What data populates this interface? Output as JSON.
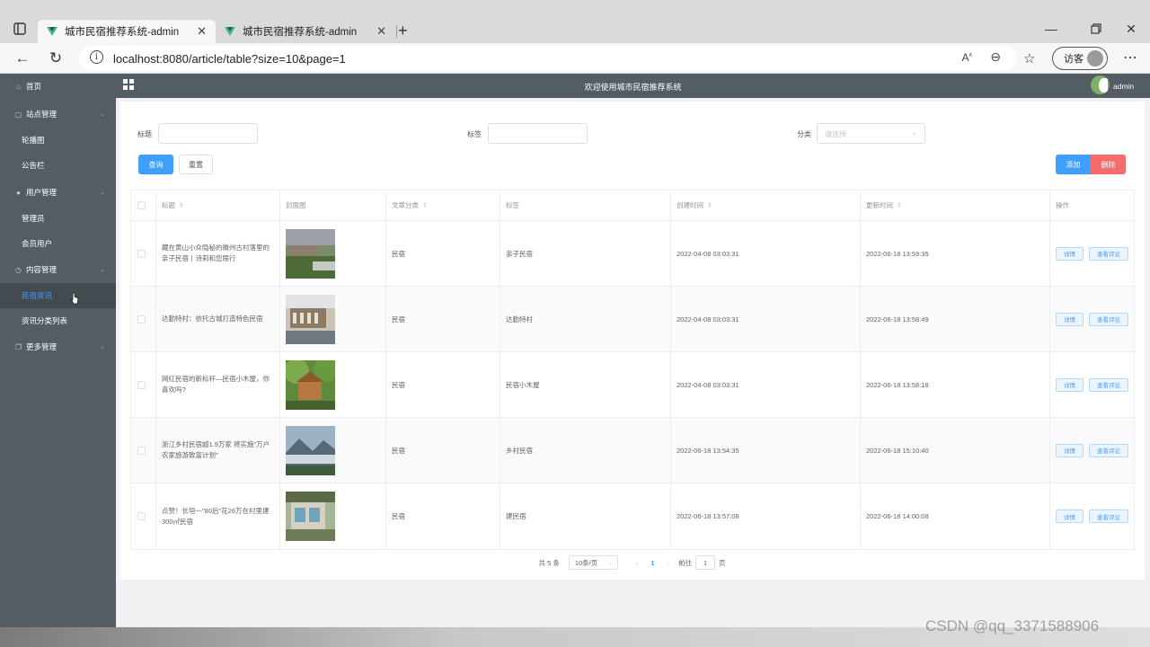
{
  "browser": {
    "tabs": [
      {
        "title": "城市民宿推荐系统-admin",
        "active": true
      },
      {
        "title": "城市民宿推荐系统-admin",
        "active": false
      }
    ],
    "url": "localhost:8080/article/table?size=10&page=1",
    "guest_label": "访客"
  },
  "sidebar": {
    "items": [
      {
        "label": "首页",
        "icon": "home-icon",
        "type": "top"
      },
      {
        "label": "站点管理",
        "icon": "folder-icon",
        "type": "group"
      },
      {
        "label": "轮播图",
        "type": "sub"
      },
      {
        "label": "公告栏",
        "type": "sub"
      },
      {
        "label": "用户管理",
        "icon": "user-icon",
        "type": "group"
      },
      {
        "label": "管理员",
        "type": "sub"
      },
      {
        "label": "会员用户",
        "type": "sub"
      },
      {
        "label": "内容管理",
        "icon": "clock-icon",
        "type": "group"
      },
      {
        "label": "民宿资讯",
        "type": "sub",
        "active": true
      },
      {
        "label": "资讯分类列表",
        "type": "sub"
      },
      {
        "label": "更多管理",
        "icon": "copy-icon",
        "type": "group"
      }
    ]
  },
  "header": {
    "title": "欢迎使用城市民宿推荐系统",
    "user": "admin"
  },
  "filters": {
    "title_label": "标题",
    "tag_label": "标签",
    "category_label": "分类",
    "category_placeholder": "请选择",
    "search_button": "查询",
    "reset_button": "重置",
    "add_button": "添加",
    "delete_button": "删除"
  },
  "table": {
    "columns": [
      "标题",
      "封面图",
      "文章分类",
      "标签",
      "创建时间",
      "更新时间",
      "操作"
    ],
    "detail_label": "详情",
    "comments_label": "查看评论",
    "rows": [
      {
        "title": "藏在黄山小众隐秘的徽州古村落里的亲子民宿丨诗莉和您限行",
        "category": "民宿",
        "tag": "亲子民宿",
        "created": "2022-04-08 03:03:31",
        "updated": "2022-06-18 13:59:35"
      },
      {
        "title": "达勤特村：依托古城打造特色民宿",
        "category": "民宿",
        "tag": "达勤特村",
        "created": "2022-04-08 03:03:31",
        "updated": "2022-06-18 13:58:49"
      },
      {
        "title": "网红民宿的新标杆—民宿小木屋，你喜欢吗?",
        "category": "民宿",
        "tag": "民宿小木屋",
        "created": "2022-04-08 03:03:31",
        "updated": "2022-06-18 13:58:18"
      },
      {
        "title": "浙江乡村民宿超1.9万家 将实施\"万户农家旅游致富计划\"",
        "category": "民宿",
        "tag": "乡村民宿",
        "created": "2022-06-18 13:54:35",
        "updated": "2022-06-18 15:10:40"
      },
      {
        "title": "点赞！长垣一\"80后\"花26万在村里建300㎡民宿",
        "category": "民宿",
        "tag": "建民宿",
        "created": "2022-06-18 13:57:08",
        "updated": "2022-06-18 14:00:08"
      }
    ]
  },
  "pagination": {
    "total_text": "共 5 条",
    "page_size": "10条/页",
    "current_page": "1",
    "goto_label": "前往",
    "goto_value": "1",
    "page_unit": "页"
  },
  "watermark": "CSDN @qq_3371588906"
}
